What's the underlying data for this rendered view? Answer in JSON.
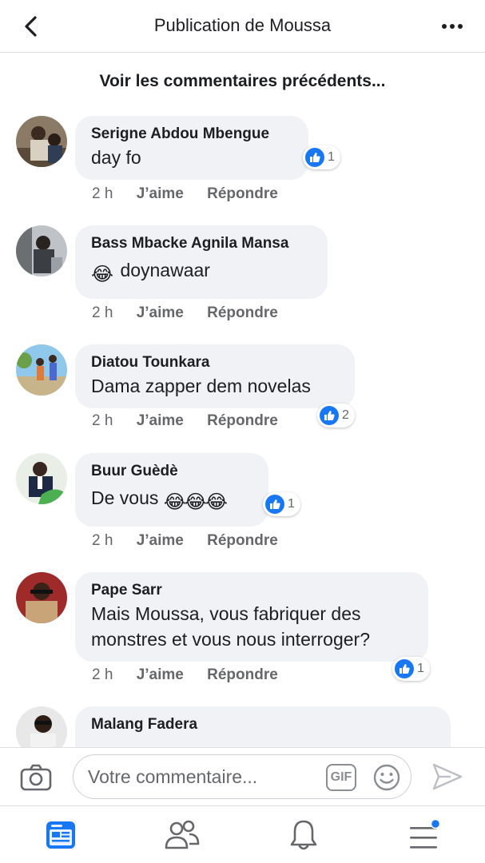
{
  "header": {
    "title": "Publication de Moussa"
  },
  "prev_comments_label": "Voir les commentaires précédents...",
  "actions": {
    "like": "J’aime",
    "reply": "Répondre"
  },
  "comments": [
    {
      "author": "Serigne Abdou Mbengue",
      "text": "day fo",
      "time": "2 h",
      "reactions": "1"
    },
    {
      "author": "Bass Mbacke Agnila Mansa",
      "text": "doynawaar",
      "time": "2 h",
      "emoji_prefix": "😂"
    },
    {
      "author": "Diatou Tounkara",
      "text": "Dama zapper dem novelas",
      "time": "2 h",
      "reactions": "2"
    },
    {
      "author": "Buur Guèdè",
      "text": "De vous",
      "time": "2 h",
      "reactions": "1",
      "emoji_suffix": "😂😂😂"
    },
    {
      "author": "Pape Sarr",
      "text_line1": "Mais Moussa, vous fabriquer des",
      "text_line2": "monstres et vous nous interroger?",
      "time": "2 h",
      "reactions": "1"
    },
    {
      "author": "Malang Fadera"
    }
  ],
  "composer": {
    "placeholder": "Votre commentaire...",
    "gif_label": "GIF"
  },
  "icons": [
    "back-icon",
    "more-icon",
    "like-icon",
    "camera-icon",
    "gif-icon",
    "smiley-icon",
    "send-icon",
    "news-feed-icon",
    "friends-icon",
    "notifications-icon",
    "menu-icon"
  ],
  "colors": {
    "accent": "#1877f2",
    "bubble": "#f0f2f5",
    "meta": "#65676b"
  }
}
